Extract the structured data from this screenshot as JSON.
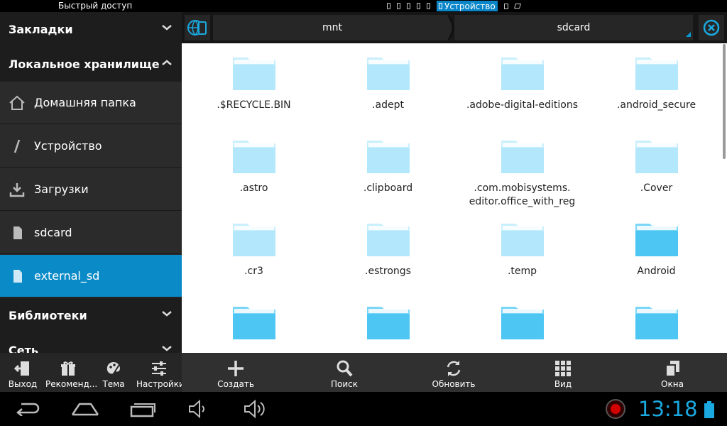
{
  "statusbar": {
    "title": "Быстрый доступ",
    "active_device": "Устройство"
  },
  "sidebar": {
    "sections": [
      {
        "label": "Закладки",
        "expanded": false
      },
      {
        "label": "Локальное хранилище",
        "expanded": true
      },
      {
        "label": "Библиотеки",
        "expanded": false
      },
      {
        "label": "Сеть",
        "expanded": false
      }
    ],
    "items": [
      {
        "label": "Домашняя папка",
        "icon": "home-icon"
      },
      {
        "label": "Устройство",
        "icon": "slash-icon"
      },
      {
        "label": "Загрузки",
        "icon": "download-icon"
      },
      {
        "label": "sdcard",
        "icon": "sdcard-icon"
      },
      {
        "label": "external_sd",
        "icon": "sdcard-icon",
        "active": true
      }
    ]
  },
  "pathbar": {
    "crumbs": [
      "mnt",
      "sdcard"
    ]
  },
  "files": [
    {
      "line1": ".$RECYCLE.BIN",
      "line2": "",
      "hidden": true
    },
    {
      "line1": ".adept",
      "line2": "",
      "hidden": true
    },
    {
      "line1": ".adobe-digital-editions",
      "line2": "",
      "hidden": true
    },
    {
      "line1": ".android_secure",
      "line2": "",
      "hidden": true
    },
    {
      "line1": ".astro",
      "line2": "",
      "hidden": true
    },
    {
      "line1": ".clipboard",
      "line2": "",
      "hidden": true
    },
    {
      "line1": ".com.mobisystems.",
      "line2": "editor.office_with_reg",
      "hidden": true
    },
    {
      "line1": ".Cover",
      "line2": "",
      "hidden": true
    },
    {
      "line1": ".cr3",
      "line2": "",
      "hidden": true
    },
    {
      "line1": ".estrongs",
      "line2": "",
      "hidden": true
    },
    {
      "line1": ".temp",
      "line2": "",
      "hidden": true
    },
    {
      "line1": "Android",
      "line2": "",
      "hidden": false
    },
    {
      "line1": "",
      "line2": "",
      "hidden": false
    },
    {
      "line1": "",
      "line2": "",
      "hidden": false
    },
    {
      "line1": "",
      "line2": "",
      "hidden": false
    },
    {
      "line1": "",
      "line2": "",
      "hidden": false
    }
  ],
  "left_toolbar": [
    {
      "label": "Выход",
      "icon": "exit-icon"
    },
    {
      "label": "Рекоменд...",
      "icon": "gift-icon"
    },
    {
      "label": "Тема",
      "icon": "palette-icon"
    },
    {
      "label": "Настройки",
      "icon": "sliders-icon"
    }
  ],
  "right_toolbar": [
    {
      "label": "Создать",
      "icon": "plus-icon"
    },
    {
      "label": "Поиск",
      "icon": "search-icon"
    },
    {
      "label": "Обновить",
      "icon": "refresh-icon"
    },
    {
      "label": "Вид",
      "icon": "grid-icon"
    },
    {
      "label": "Окна",
      "icon": "windows-icon"
    }
  ],
  "system": {
    "time": "13:18"
  },
  "colors": {
    "accent": "#0a8ac6",
    "folder_light": "#b3e7fb",
    "folder_dark": "#4dc6f3",
    "clock": "#1aa9e0"
  }
}
